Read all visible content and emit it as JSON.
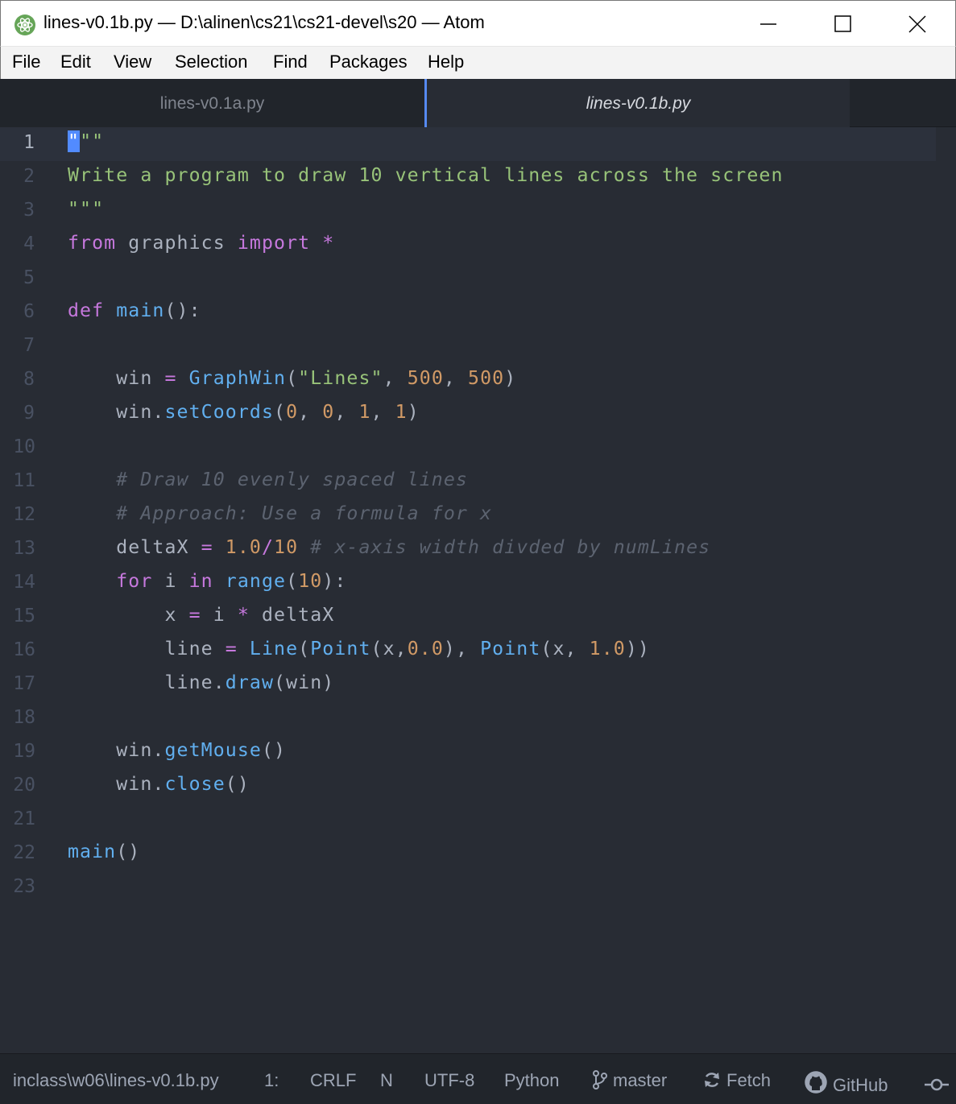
{
  "window": {
    "title": "lines-v0.1b.py — D:\\alinen\\cs21\\cs21-devel\\s20 — Atom",
    "controls": [
      "minimize",
      "maximize",
      "close"
    ]
  },
  "menu": [
    "File",
    "Edit",
    "View",
    "Selection",
    "Find",
    "Packages",
    "Help"
  ],
  "tabs": [
    {
      "label": "lines-v0.1a.py",
      "active": false
    },
    {
      "label": "lines-v0.1b.py",
      "active": true
    }
  ],
  "editor": {
    "line_numbers": [
      "1",
      "2",
      "3",
      "4",
      "5",
      "6",
      "7",
      "8",
      "9",
      "10",
      "11",
      "12",
      "13",
      "14",
      "15",
      "16",
      "17",
      "18",
      "19",
      "20",
      "21",
      "22",
      "23"
    ],
    "current_line": 1
  },
  "code": {
    "l1": "\"\"\"",
    "l2": "Write a program to draw 10 vertical lines across the screen",
    "l3": "\"\"\"",
    "l4": {
      "kw_from": "from",
      "module": " graphics ",
      "kw_import": "import",
      "star": " *"
    },
    "l6": {
      "kw_def": "def",
      "name": "main",
      "rest": "():"
    },
    "l8": {
      "pre": "    win ",
      "eq": "=",
      "fn": "GraphWin",
      "p1": "(",
      "str": "\"Lines\"",
      "c1": ", ",
      "n1": "500",
      "c2": ", ",
      "n2": "500",
      "p2": ")"
    },
    "l9": {
      "pre": "    win.",
      "fn": "setCoords",
      "p1": "(",
      "n1": "0",
      "c1": ", ",
      "n2": "0",
      "c2": ", ",
      "n3": "1",
      "c3": ", ",
      "n4": "1",
      "p2": ")"
    },
    "l11": "    # Draw 10 evenly spaced lines",
    "l12": "    # Approach: Use a formula for x",
    "l13": {
      "pre": "    deltaX ",
      "eq": "=",
      "n1": "1.0",
      "div": "/",
      "n2": "10",
      "comment": " # x-axis width divded by numLines"
    },
    "l14": {
      "pre": "    ",
      "kw_for": "for",
      "mid": " i ",
      "kw_in": "in",
      "fn": " range",
      "p1": "(",
      "n1": "10",
      "p2": "):"
    },
    "l15": {
      "pre": "        x ",
      "eq": "=",
      "mid": " i ",
      "op": "*",
      "post": " deltaX"
    },
    "l16": {
      "pre": "        line ",
      "eq": "=",
      "fn1": " Line",
      "p1": "(",
      "fn2": "Point",
      "a1": "(x,",
      "n1": "0.0",
      "a2": "), ",
      "fn3": "Point",
      "a3": "(x, ",
      "n2": "1.0",
      "a4": "))"
    },
    "l17": {
      "pre": "        line.",
      "fn": "draw",
      "post": "(win)"
    },
    "l19": {
      "pre": "    win.",
      "fn": "getMouse",
      "post": "()"
    },
    "l20": {
      "pre": "    win.",
      "fn": "close",
      "post": "()"
    },
    "l22": {
      "fn": "main",
      "post": "()"
    }
  },
  "status": {
    "path": "inclass\\w06\\lines-v0.1b.py",
    "cursor": "1:",
    "line_ending": "CRLF",
    "indent": "N",
    "encoding": "UTF-8",
    "grammar": "Python",
    "branch": "master",
    "fetch": "Fetch",
    "github": "GitHub"
  },
  "colors": {
    "editor_bg": "#282c34",
    "keyword": "#c678dd",
    "function": "#61afef",
    "string": "#98c379",
    "number": "#d19a66",
    "comment": "#5c6370",
    "accent": "#568af2"
  }
}
